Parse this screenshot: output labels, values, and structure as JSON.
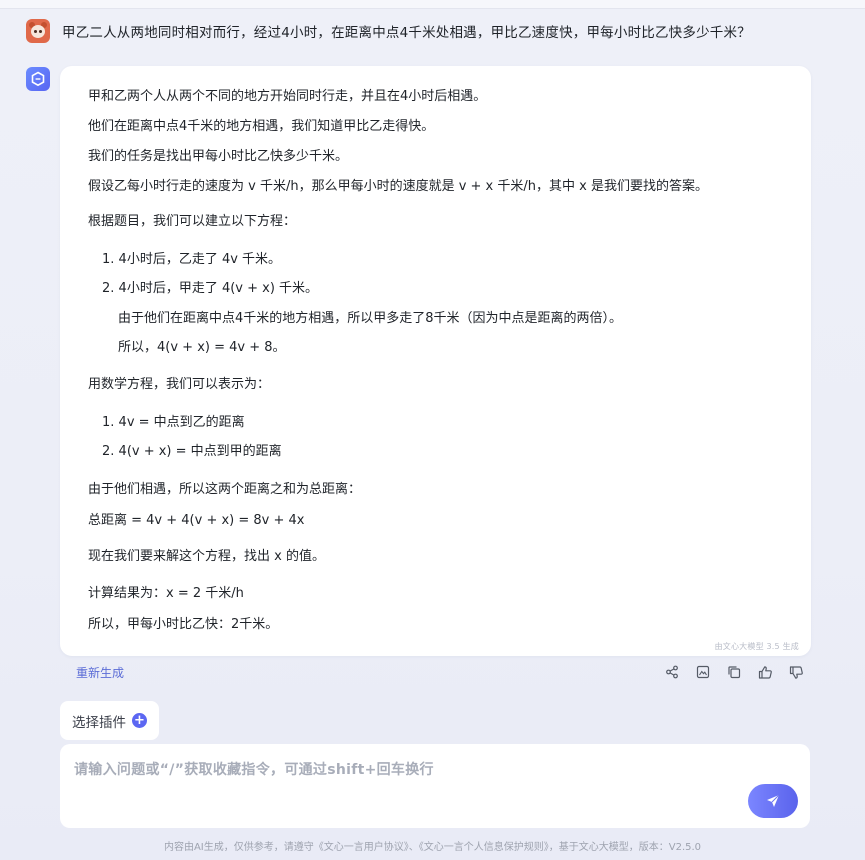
{
  "question": "甲乙二人从两地同时相对而行，经过4小时，在距离中点4千米处相遇，甲比乙速度快，甲每小时比乙快多少千米？",
  "answer": {
    "p1": "甲和乙两个人从两个不同的地方开始同时行走，并且在4小时后相遇。",
    "p2": "他们在距离中点4千米的地方相遇，我们知道甲比乙走得快。",
    "p3": "我们的任务是找出甲每小时比乙快多少千米。",
    "p4": "假设乙每小时行走的速度为 v 千米/h，那么甲每小时的速度就是 v + x 千米/h，其中 x 是我们要找的答案。",
    "p5": "根据题目，我们可以建立以下方程：",
    "list1": [
      {
        "num": "1.",
        "text": "4小时后，乙走了 4v 千米。"
      },
      {
        "num": "2.",
        "text": "4小时后，甲走了 4(v + x) 千米。"
      }
    ],
    "sub1": "由于他们在距离中点4千米的地方相遇，所以甲多走了8千米（因为中点是距离的两倍）。",
    "sub2": "所以，4(v + x) = 4v + 8。",
    "p6": "用数学方程，我们可以表示为：",
    "list2": [
      {
        "num": "1.",
        "text": "4v = 中点到乙的距离"
      },
      {
        "num": "2.",
        "text": "4(v + x) = 中点到甲的距离"
      }
    ],
    "p7": "由于他们相遇，所以这两个距离之和为总距离：",
    "p8": "总距离 = 4v + 4(v + x) = 8v + 4x",
    "p9": "现在我们要来解这个方程，找出 x 的值。",
    "p10": "计算结果为：x = 2 千米/h",
    "p11": "所以，甲每小时比乙快：2千米。",
    "watermark": "由文心大模型 3.5 生成"
  },
  "actions": {
    "regenerate": "重新生成",
    "icons": [
      "share-icon",
      "image-icon",
      "copy-icon",
      "thumbs-up-icon",
      "thumbs-down-icon"
    ]
  },
  "plugin": {
    "label": "选择插件"
  },
  "input": {
    "placeholder": "请输入问题或“/”获取收藏指令，可通过shift+回车换行"
  },
  "footer": "内容由AI生成，仅供参考，请遵守《文心一言用户协议》、《文心一言个人信息保护规则》，基于文心大模型，版本：V2.5.0",
  "colors": {
    "accent": "#5c67f2",
    "link": "#5b6cd6"
  }
}
